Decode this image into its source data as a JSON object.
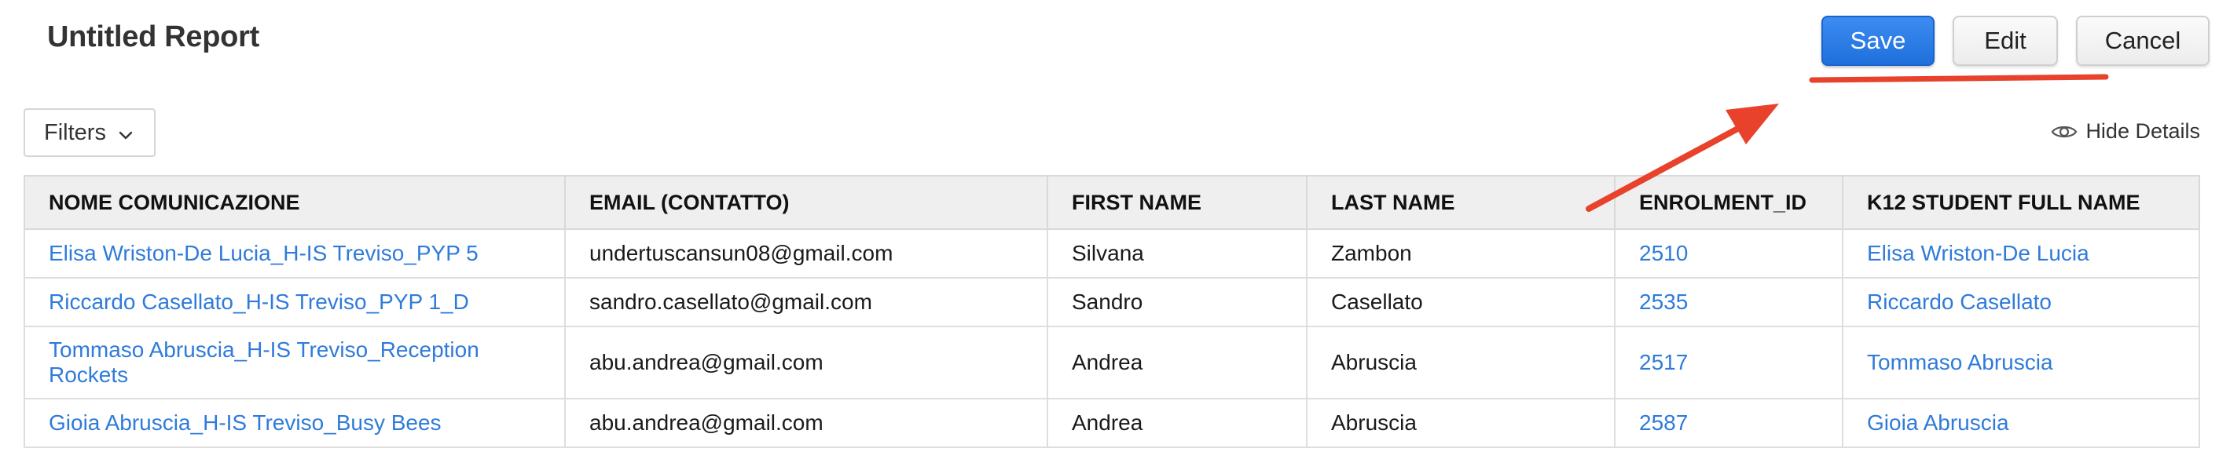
{
  "header": {
    "title": "Untitled Report",
    "save_label": "Save",
    "edit_label": "Edit",
    "cancel_label": "Cancel"
  },
  "toolbar": {
    "filters_label": "Filters",
    "hide_details_label": "Hide Details"
  },
  "table": {
    "columns": [
      "NOME COMUNICAZIONE",
      "EMAIL (CONTATTO)",
      "FIRST NAME",
      "LAST NAME",
      "ENROLMENT_ID",
      "K12 STUDENT FULL NAME"
    ],
    "rows": [
      {
        "name": "Elisa Wriston-De Lucia_H-IS Treviso_PYP 5",
        "email": "undertuscansun08@gmail.com",
        "first": "Silvana",
        "last": "Zambon",
        "enrol": "2510",
        "student": "Elisa Wriston-De Lucia"
      },
      {
        "name": "Riccardo Casellato_H-IS Treviso_PYP 1_D",
        "email": "sandro.casellato@gmail.com",
        "first": "Sandro",
        "last": "Casellato",
        "enrol": "2535",
        "student": "Riccardo Casellato"
      },
      {
        "name": "Tommaso Abruscia_H-IS Treviso_Reception Rockets",
        "email": "abu.andrea@gmail.com",
        "first": "Andrea",
        "last": "Abruscia",
        "enrol": "2517",
        "student": "Tommaso Abruscia"
      },
      {
        "name": "Gioia Abruscia_H-IS Treviso_Busy Bees",
        "email": "abu.andrea@gmail.com",
        "first": "Andrea",
        "last": "Abruscia",
        "enrol": "2587",
        "student": "Gioia Abruscia"
      }
    ]
  },
  "colors": {
    "link": "#2f7bd9",
    "primary": "#1f6fdc",
    "annotation": "#e8412c"
  }
}
